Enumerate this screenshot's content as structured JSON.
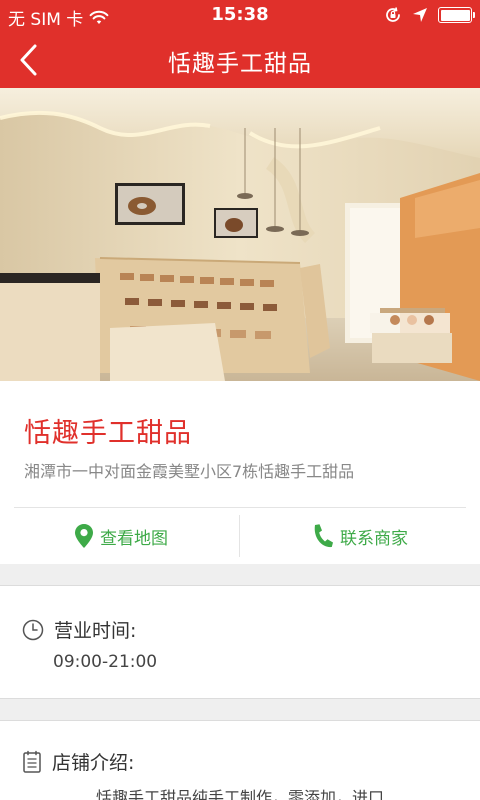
{
  "status_bar": {
    "carrier": "无 SIM 卡",
    "time": "15:38",
    "battery_level": 1.0
  },
  "nav": {
    "title": "恬趣手工甜品"
  },
  "shop": {
    "name": "恬趣手工甜品",
    "address": "湘潭市一中对面金霞美墅小区7栋恬趣手工甜品",
    "actions": {
      "map_label": "查看地图",
      "contact_label": "联系商家"
    }
  },
  "hours": {
    "heading": "营业时间:",
    "value": "09:00-21:00"
  },
  "intro": {
    "heading": "店铺介绍:",
    "text": "恬趣手工甜品纯手工制作，零添加，进口"
  },
  "colors": {
    "brand_red": "#e0302b",
    "action_green": "#3eaa48"
  }
}
